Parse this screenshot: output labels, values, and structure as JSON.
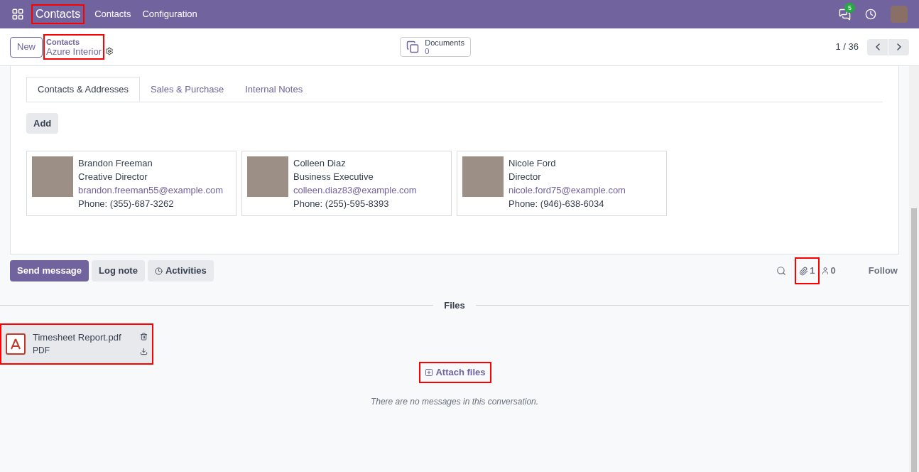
{
  "navbar": {
    "app_name": {
      "label": "Contacts",
      "highlighted": true
    },
    "menu": [
      "Contacts",
      "Configuration"
    ],
    "messages_badge": "5"
  },
  "control_panel": {
    "new_button": "New",
    "breadcrumb": {
      "parent": "Contacts",
      "current": "Azure Interior",
      "highlighted": true
    },
    "documents": {
      "label": "Documents",
      "count": "0"
    },
    "pager": "1 / 36"
  },
  "tabs": [
    {
      "label": "Contacts & Addresses",
      "selected": true
    },
    {
      "label": "Sales & Purchase",
      "selected": false
    },
    {
      "label": "Internal Notes",
      "selected": false
    }
  ],
  "add_button": "Add",
  "contacts": [
    {
      "name": "Brandon Freeman",
      "role": "Creative Director",
      "email": "brandon.freeman55@example.com",
      "phone": "Phone: (355)-687-3262"
    },
    {
      "name": "Colleen Diaz",
      "role": "Business Executive",
      "email": "colleen.diaz83@example.com",
      "phone": "Phone: (255)-595-8393"
    },
    {
      "name": "Nicole Ford",
      "role": "Director",
      "email": "nicole.ford75@example.com",
      "phone": "Phone: (946)-638-6034"
    }
  ],
  "chatter": {
    "buttons": [
      {
        "label": "Send message",
        "kind": "primary"
      },
      {
        "label": "Log note",
        "kind": "secondary"
      },
      {
        "label": "Activities",
        "kind": "activities"
      }
    ],
    "attachments": {
      "count": "1",
      "highlighted": true
    },
    "followers": "0",
    "follow": "Follow",
    "files_heading": "Files",
    "files": [
      {
        "name": "Timesheet Report.pdf",
        "type": "PDF",
        "highlighted": true
      }
    ],
    "attach": {
      "label": "Attach files",
      "highlighted": true
    },
    "empty": "There are no messages in this conversation."
  }
}
